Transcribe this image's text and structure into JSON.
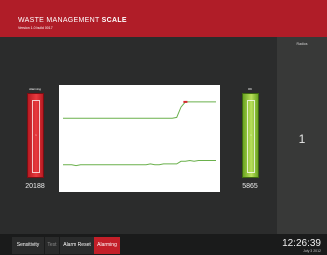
{
  "header": {
    "title_part1": "WASTE MANAGEMENT ",
    "title_part2": "SCALE",
    "version": "Version 1.0 build 0017"
  },
  "right_panel": {
    "label": "Radios",
    "value": "1"
  },
  "gauges": {
    "left": {
      "label": "Alarming",
      "value": "20188",
      "mark": "1",
      "color": "#d42a30"
    },
    "right": {
      "label": "OK",
      "value": "5865",
      "mark": "1",
      "color": "#9ccd3e"
    }
  },
  "chart_data": {
    "type": "line",
    "title": "",
    "xlabel": "",
    "ylabel": "",
    "series": [
      {
        "color": "#6ab04c",
        "values": [
          0.81,
          0.81,
          0.81,
          0.81,
          0.81,
          0.81,
          0.81,
          0.81,
          0.81,
          0.81,
          0.81,
          0.81,
          0.81,
          0.81,
          0.81,
          0.81,
          0.81,
          0.81,
          0.81,
          0.81,
          0.81,
          0.81,
          0.81,
          0.81,
          0.81,
          0.81,
          0.82,
          0.94,
          1.0,
          1.0,
          1.0,
          1.0,
          1.0,
          1.0,
          1.0,
          1.0
        ]
      },
      {
        "color": "#6ab04c",
        "values": [
          0.27,
          0.27,
          0.27,
          0.26,
          0.27,
          0.27,
          0.27,
          0.27,
          0.27,
          0.27,
          0.27,
          0.27,
          0.27,
          0.27,
          0.27,
          0.27,
          0.27,
          0.27,
          0.27,
          0.27,
          0.28,
          0.27,
          0.27,
          0.28,
          0.28,
          0.28,
          0.28,
          0.31,
          0.31,
          0.32,
          0.31,
          0.32,
          0.32,
          0.32,
          0.32,
          0.32
        ]
      }
    ],
    "marker_color": "#d42a30",
    "ylim": [
      0,
      1.15
    ]
  },
  "footer": {
    "tabs": [
      "Sensitivity",
      "Test",
      "Alarm Reset",
      "Alarming"
    ],
    "time": "12:26:39",
    "date": "July 3 2012"
  }
}
